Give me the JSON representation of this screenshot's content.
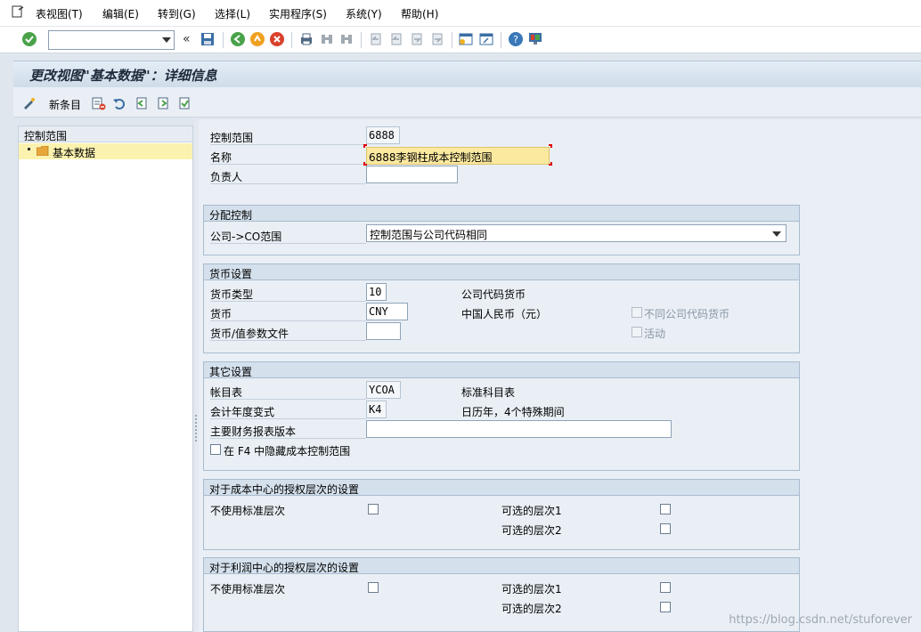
{
  "menu": {
    "items": [
      "表视图(T)",
      "编辑(E)",
      "转到(G)",
      "选择(L)",
      "实用程序(S)",
      "系统(Y)",
      "帮助(H)"
    ]
  },
  "toolbar": {
    "command_value": ""
  },
  "title": "更改视图\"基本数据\"：详细信息",
  "app_toolbar": {
    "new_entries_label": "新条目"
  },
  "tree": {
    "header": "控制范围",
    "items": [
      "基本数据"
    ]
  },
  "header_fields": {
    "control_area_label": "控制范围",
    "control_area_value": "6888",
    "name_label": "名称",
    "name_value": "6888李钢柱成本控制范围",
    "person_label": "负责人",
    "person_value": ""
  },
  "assignment_control": {
    "title": "分配控制",
    "company_co_label": "公司->CO范围",
    "company_co_value": "控制范围与公司代码相同"
  },
  "currency_settings": {
    "title": "货币设置",
    "currency_type_label": "货币类型",
    "currency_type_value": "10",
    "currency_type_desc": "公司代码货币",
    "currency_label": "货币",
    "currency_value": "CNY",
    "currency_desc": "中国人民币（元）",
    "profile_label": "货币/值参数文件",
    "profile_value": "",
    "diff_company_cb_label": "不同公司代码货币",
    "active_cb_label": "活动"
  },
  "other_settings": {
    "title": "其它设置",
    "coa_label": "帐目表",
    "coa_value": "YCOA",
    "coa_desc": "标准科目表",
    "fy_label": "会计年度变式",
    "fy_value": "K4",
    "fy_desc": "日历年，4个特殊期间",
    "report_label": "主要财务报表版本",
    "report_value": "",
    "hide_f4_label": "在 F4 中隐藏成本控制范围"
  },
  "cost_center_auth": {
    "title": "对于成本中心的授权层次的设置",
    "no_std_label": "不使用标准层次",
    "opt1_label": "可选的层次1",
    "opt2_label": "可选的层次2"
  },
  "profit_center_auth": {
    "title": "对于利润中心的授权层次的设置",
    "no_std_label": "不使用标准层次",
    "opt1_label": "可选的层次1",
    "opt2_label": "可选的层次2"
  },
  "watermark": "https://blog.csdn.net/stuforever",
  "colors": {
    "background": "#dfe6ee",
    "group_header": "#d4e0ec",
    "selected_field": "#fbe9a0",
    "tree_selected": "#fbf2b0"
  }
}
